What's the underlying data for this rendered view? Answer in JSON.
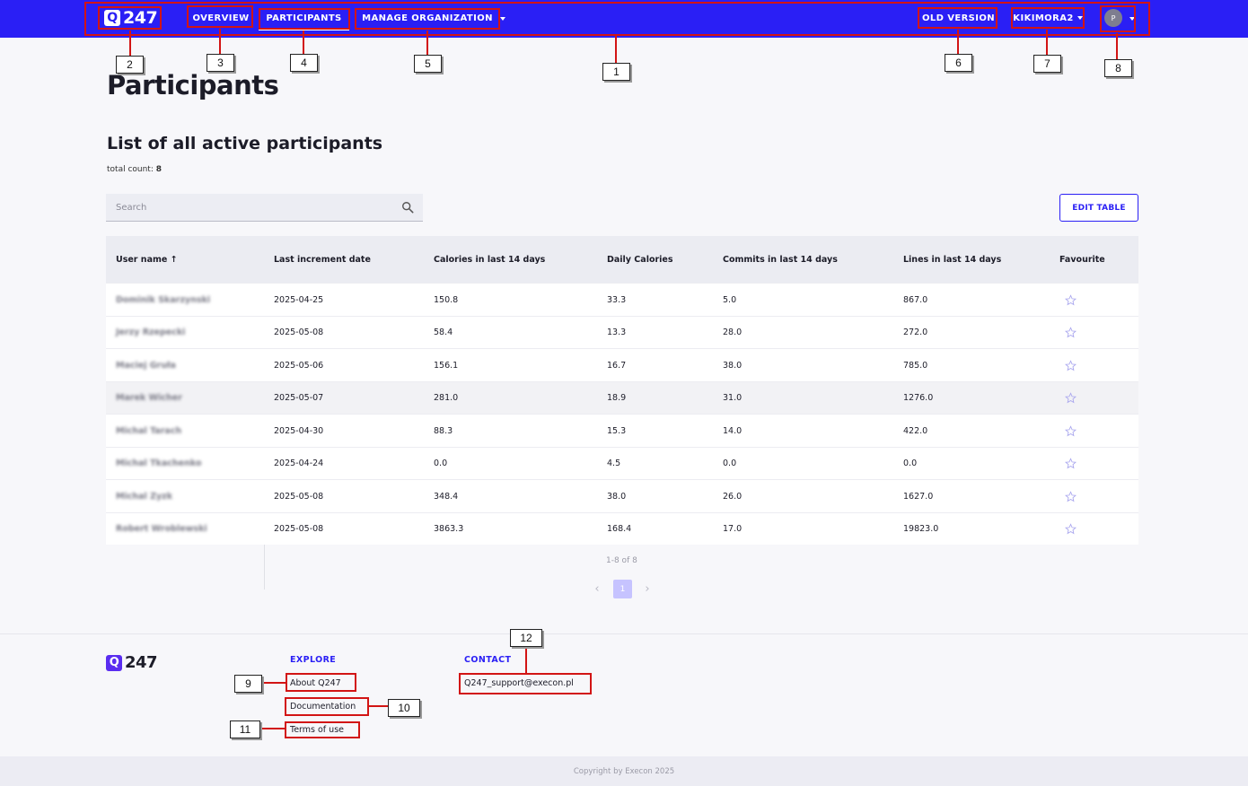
{
  "nav": {
    "logo": "247",
    "overview": "OVERVIEW",
    "participants": "PARTICIPANTS",
    "manage": "MANAGE ORGANIZATION",
    "old_version": "OLD VERSION",
    "org": "KIKIMORA2",
    "avatar": "P"
  },
  "page": {
    "title": "Participants",
    "list_title": "List of all active participants",
    "count_label": "total count:",
    "count_value": "8"
  },
  "search": {
    "placeholder": "Search"
  },
  "edit_table": "EDIT TABLE",
  "table": {
    "headers": [
      "User name ↑",
      "Last increment date",
      "Calories in last 14 days",
      "Daily Calories",
      "Commits in last 14 days",
      "Lines in last 14 days",
      "Favourite"
    ],
    "rows": [
      [
        "Dominik Skarzynski",
        "2025-04-25",
        "150.8",
        "33.3",
        "5.0",
        "867.0"
      ],
      [
        "Jerzy Rzepecki",
        "2025-05-08",
        "58.4",
        "13.3",
        "28.0",
        "272.0"
      ],
      [
        "Maciej Gruła",
        "2025-05-06",
        "156.1",
        "16.7",
        "38.0",
        "785.0"
      ],
      [
        "Marek Wicher",
        "2025-05-07",
        "281.0",
        "18.9",
        "31.0",
        "1276.0"
      ],
      [
        "Michal Tarach",
        "2025-04-30",
        "88.3",
        "15.3",
        "14.0",
        "422.0"
      ],
      [
        "Michal Tkachenko",
        "2025-04-24",
        "0.0",
        "4.5",
        "0.0",
        "0.0"
      ],
      [
        "Michal Zyzk",
        "2025-05-08",
        "348.4",
        "38.0",
        "26.0",
        "1627.0"
      ],
      [
        "Robert Wroblewski",
        "2025-05-08",
        "3863.3",
        "168.4",
        "17.0",
        "19823.0"
      ]
    ]
  },
  "pager": {
    "info": "1-8 of 8",
    "page": "1",
    "prev": "‹",
    "next": "›"
  },
  "footer": {
    "logo": "247",
    "explore": "EXPLORE",
    "about": "About Q247",
    "docs": "Documentation",
    "terms": "Terms of use",
    "contact": "CONTACT",
    "email": "Q247_support@execon.pl",
    "copyright": "Copyright by Execon 2025"
  },
  "markers": [
    "1",
    "2",
    "3",
    "4",
    "5",
    "6",
    "7",
    "8",
    "9",
    "10",
    "11",
    "12"
  ],
  "colors": {
    "brand": "#2a1ff5",
    "annotation": "#d21414"
  }
}
